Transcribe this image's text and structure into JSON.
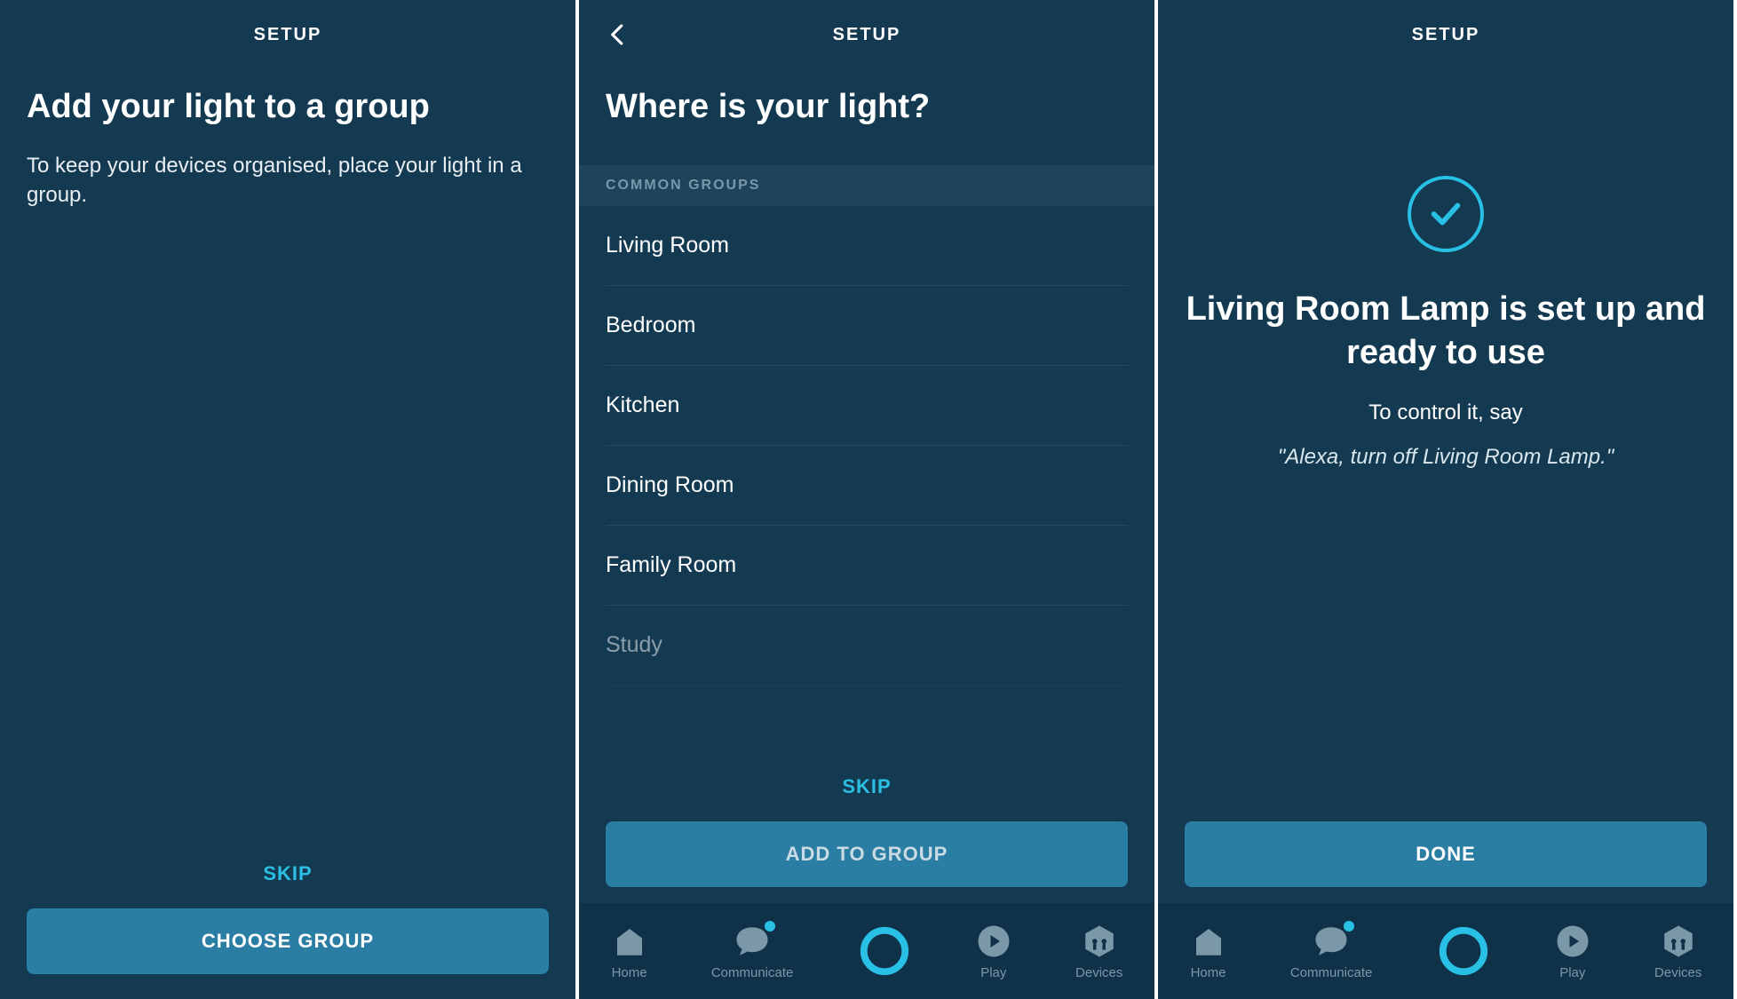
{
  "colors": {
    "bg": "#143A52",
    "accent": "#29c0e6",
    "button": "#2b7ea3"
  },
  "screen1": {
    "header": "SETUP",
    "title": "Add your light to a group",
    "subtitle": "To keep your devices organised, place your light in a group.",
    "skip": "SKIP",
    "primary": "CHOOSE GROUP"
  },
  "screen2": {
    "header": "SETUP",
    "title": "Where is your light?",
    "section": "COMMON GROUPS",
    "groups": [
      "Living Room",
      "Bedroom",
      "Kitchen",
      "Dining Room",
      "Family Room",
      "Study"
    ],
    "skip": "SKIP",
    "primary": "ADD TO GROUP",
    "tabs": [
      "Home",
      "Communicate",
      "",
      "Play",
      "Devices"
    ]
  },
  "screen3": {
    "header": "SETUP",
    "success_title": "Living Room Lamp is set up and ready to use",
    "success_sub": "To control it, say",
    "success_quote": "\"Alexa, turn off Living Room Lamp.\"",
    "primary": "DONE",
    "tabs": [
      "Home",
      "Communicate",
      "",
      "Play",
      "Devices"
    ]
  }
}
